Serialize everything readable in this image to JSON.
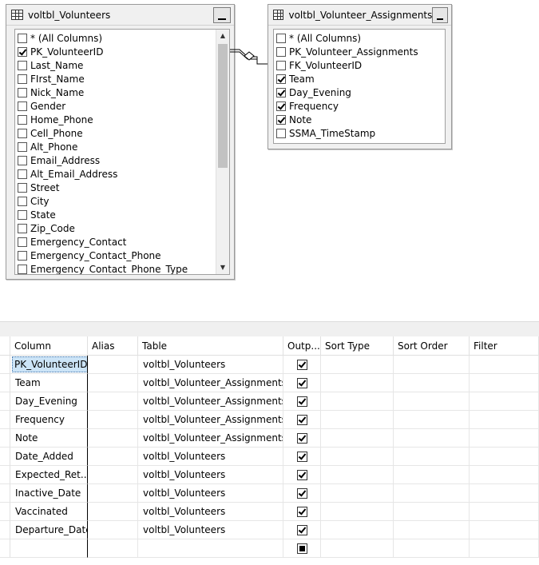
{
  "tables": {
    "volunteers": {
      "title": "voltbl_Volunteers",
      "columns": [
        {
          "label": "* (All Columns)",
          "checked": false
        },
        {
          "label": "PK_VolunteerID",
          "checked": true
        },
        {
          "label": "Last_Name",
          "checked": false
        },
        {
          "label": "FIrst_Name",
          "checked": false
        },
        {
          "label": "Nick_Name",
          "checked": false
        },
        {
          "label": "Gender",
          "checked": false
        },
        {
          "label": "Home_Phone",
          "checked": false
        },
        {
          "label": "Cell_Phone",
          "checked": false
        },
        {
          "label": "Alt_Phone",
          "checked": false
        },
        {
          "label": "Email_Address",
          "checked": false
        },
        {
          "label": "Alt_Email_Address",
          "checked": false
        },
        {
          "label": "Street",
          "checked": false
        },
        {
          "label": "City",
          "checked": false
        },
        {
          "label": "State",
          "checked": false
        },
        {
          "label": "Zip_Code",
          "checked": false
        },
        {
          "label": "Emergency_Contact",
          "checked": false
        },
        {
          "label": "Emergency_Contact_Phone",
          "checked": false
        },
        {
          "label": "Emergency_Contact_Phone_Type",
          "checked": false
        }
      ]
    },
    "assignments": {
      "title": "voltbl_Volunteer_Assignments",
      "columns": [
        {
          "label": "* (All Columns)",
          "checked": false
        },
        {
          "label": "PK_Volunteer_Assignments",
          "checked": false
        },
        {
          "label": "FK_VolunteerID",
          "checked": false
        },
        {
          "label": "Team",
          "checked": true
        },
        {
          "label": "Day_Evening",
          "checked": true
        },
        {
          "label": "Frequency",
          "checked": true
        },
        {
          "label": "Note",
          "checked": true
        },
        {
          "label": "SSMA_TimeStamp",
          "checked": false
        }
      ]
    }
  },
  "grid": {
    "headers": [
      "Column",
      "Alias",
      "Table",
      "Outp...",
      "Sort Type",
      "Sort Order",
      "Filter"
    ],
    "rows": [
      {
        "column": "PK_VolunteerID",
        "alias": "",
        "table": "voltbl_Volunteers",
        "output": "checked"
      },
      {
        "column": "Team",
        "alias": "",
        "table": "voltbl_Volunteer_Assignments",
        "output": "checked"
      },
      {
        "column": "Day_Evening",
        "alias": "",
        "table": "voltbl_Volunteer_Assignments",
        "output": "checked"
      },
      {
        "column": "Frequency",
        "alias": "",
        "table": "voltbl_Volunteer_Assignments",
        "output": "checked"
      },
      {
        "column": "Note",
        "alias": "",
        "table": "voltbl_Volunteer_Assignments",
        "output": "checked"
      },
      {
        "column": "Date_Added",
        "alias": "",
        "table": "voltbl_Volunteers",
        "output": "checked"
      },
      {
        "column": "Expected_Ret...",
        "alias": "",
        "table": "voltbl_Volunteers",
        "output": "checked"
      },
      {
        "column": "Inactive_Date",
        "alias": "",
        "table": "voltbl_Volunteers",
        "output": "checked"
      },
      {
        "column": "Vaccinated",
        "alias": "",
        "table": "voltbl_Volunteers",
        "output": "checked"
      },
      {
        "column": "Departure_Date",
        "alias": "",
        "table": "voltbl_Volunteers",
        "output": "checked"
      },
      {
        "column": "",
        "alias": "",
        "table": "",
        "output": "filled"
      }
    ]
  }
}
